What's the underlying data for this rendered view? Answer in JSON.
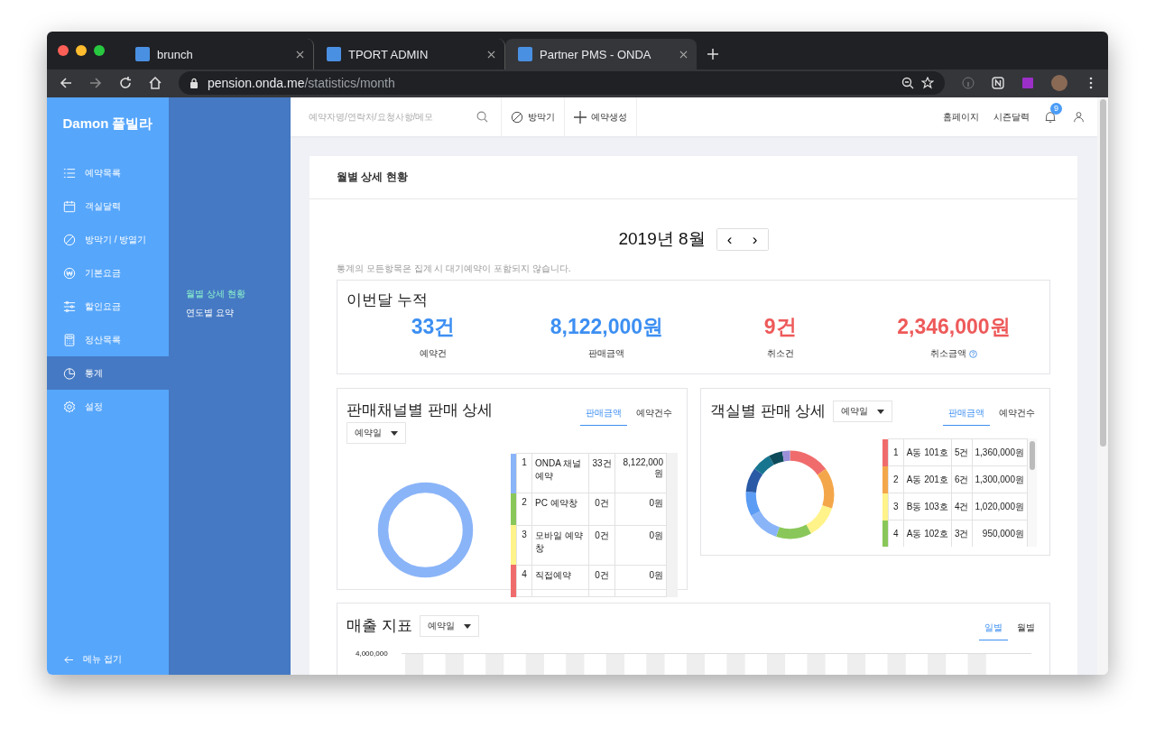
{
  "browser": {
    "tabs": [
      {
        "label": "brunch",
        "selected": false
      },
      {
        "label": "TPORT ADMIN",
        "selected": false
      },
      {
        "label": "Partner PMS - ONDA",
        "selected": true
      }
    ],
    "url_host": "pension.onda.me",
    "url_path": "/statistics/month"
  },
  "sidebar": {
    "title": "Damon 풀빌라",
    "items": [
      {
        "label": "예약목록",
        "kind": "list",
        "selected": false
      },
      {
        "label": "객실달력",
        "kind": "calendar",
        "selected": false
      },
      {
        "label": "방막기 / 방열기",
        "kind": "block",
        "selected": false
      },
      {
        "label": "기본요금",
        "kind": "won",
        "selected": false
      },
      {
        "label": "할인요금",
        "kind": "sliders",
        "selected": false
      },
      {
        "label": "정산목록",
        "kind": "calculator",
        "selected": false
      },
      {
        "label": "통계",
        "kind": "pie",
        "selected": true
      },
      {
        "label": "설정",
        "kind": "gear",
        "selected": false
      }
    ],
    "collapse": "메뉴 접기",
    "subitems": [
      {
        "label": "월별 상세 현황",
        "selected": true
      },
      {
        "label": "연도별 요약",
        "selected": false
      }
    ]
  },
  "header": {
    "search_placeholder": "예약자명/연락처/요청사항/메모",
    "block_button": "방막기",
    "create_button": "예약생성",
    "homepage": "홈페이지",
    "season_calendar": "시즌달력",
    "notification_count": "9"
  },
  "page": {
    "title": "월별 상세 현황",
    "month": "2019년 8월",
    "prev": "‹",
    "next": "›",
    "note": "통계의 모든항목은 집계 시 대기예약이 포함되지 않습니다.",
    "summary": {
      "title": "이번달 누적",
      "stats": [
        {
          "value": "33건",
          "label": "예약건",
          "kind": "positive",
          "help": false
        },
        {
          "value": "8,122,000원",
          "label": "판매금액",
          "kind": "positive",
          "help": false
        },
        {
          "value": "9건",
          "label": "취소건",
          "kind": "negative",
          "help": false
        },
        {
          "value": "2,346,000원",
          "label": "취소금액",
          "kind": "negative",
          "help": true
        }
      ]
    },
    "channel": {
      "title": "판매채널별 판매 상세",
      "filter": "예약일",
      "tabs": [
        {
          "label": "판매금액",
          "selected": true
        },
        {
          "label": "예약건수",
          "selected": false
        }
      ],
      "rows": [
        {
          "index": "1",
          "name": "ONDA 채널 예약",
          "count": "33건",
          "amount": "8,122,000원",
          "color": "#8ab4f8"
        },
        {
          "index": "2",
          "name": "PC 예약창",
          "count": "0건",
          "amount": "0원",
          "color": "#8ac75a"
        },
        {
          "index": "3",
          "name": "모바일 예약창",
          "count": "0건",
          "amount": "0원",
          "color": "#fff38a"
        },
        {
          "index": "4",
          "name": "직접예약",
          "count": "0건",
          "amount": "0원",
          "color": "#f06c6c"
        }
      ]
    },
    "room": {
      "title": "객실별 판매 상세",
      "filter": "예약일",
      "tabs": [
        {
          "label": "판매금액",
          "selected": true
        },
        {
          "label": "예약건수",
          "selected": false
        }
      ],
      "rows": [
        {
          "index": "1",
          "name": "A동 101호",
          "count": "5건",
          "amount": "1,360,000원",
          "color": "#f06c6c"
        },
        {
          "index": "2",
          "name": "A동 201호",
          "count": "6건",
          "amount": "1,300,000원",
          "color": "#f4a74a"
        },
        {
          "index": "3",
          "name": "B동 103호",
          "count": "4건",
          "amount": "1,020,000원",
          "color": "#fff38a"
        },
        {
          "index": "4",
          "name": "A동 102호",
          "count": "3건",
          "amount": "950,000원",
          "color": "#8ac75a"
        }
      ]
    },
    "sales": {
      "title": "매출 지표",
      "filter": "예약일",
      "tabs": [
        {
          "label": "일별",
          "selected": true
        },
        {
          "label": "월별",
          "selected": false
        }
      ],
      "y_label": "4,000,000"
    }
  }
}
